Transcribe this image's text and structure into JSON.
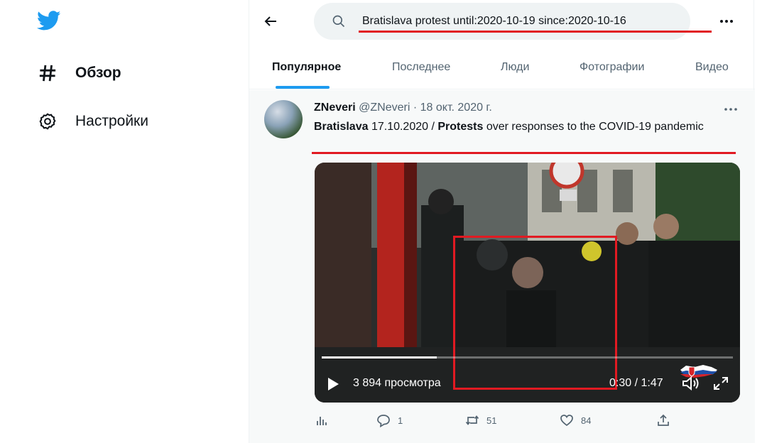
{
  "nav": {
    "logo": "twitter-bird-icon",
    "items": [
      {
        "label": "Обзор",
        "icon": "hashtag-icon"
      },
      {
        "label": "Настройки",
        "icon": "gear-icon"
      }
    ]
  },
  "search": {
    "value": "Bratislava protest until:2020-10-19 since:2020-10-16",
    "icon": "search-icon"
  },
  "tabs": [
    {
      "label": "Популярное",
      "active": true
    },
    {
      "label": "Последнее"
    },
    {
      "label": "Люди"
    },
    {
      "label": "Фотографии"
    },
    {
      "label": "Видео"
    }
  ],
  "tweet": {
    "name": "ZNeveri",
    "handle": "@ZNeveri",
    "separator": " · ",
    "date": "18 окт. 2020 г.",
    "text": {
      "w1": "Bratislava",
      "t1": " 17.10.2020 / ",
      "w2": "Protests",
      "t2": " over responses to the COVID-19 pandemic"
    },
    "video": {
      "views": "3 894 просмотра",
      "time": "0:30 / 1:47",
      "progress": 0.28
    },
    "stats": {
      "replies": "1",
      "retweets": "51",
      "likes": "84"
    }
  },
  "colors": {
    "accent": "#1d9bf0",
    "annotation_red": "#e11a22",
    "text_secondary": "#536471"
  }
}
